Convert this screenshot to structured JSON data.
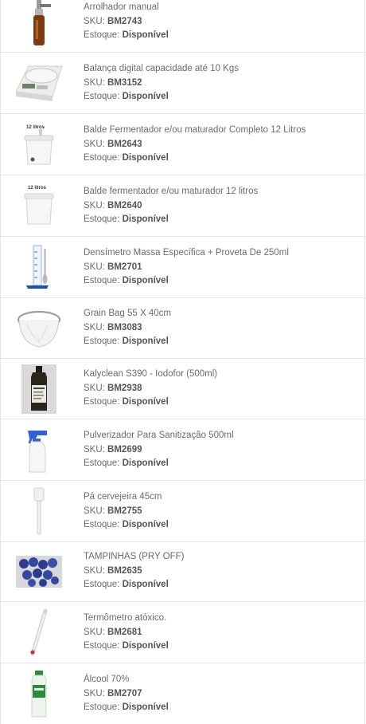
{
  "labels": {
    "sku": "SKU:",
    "stock": "Estoque:"
  },
  "items": [
    {
      "name": "Arrolhador manual",
      "sku": "BM2743",
      "stock": "Disponível",
      "image": "capper-icon"
    },
    {
      "name": "Balança digital capacidade até 10 Kgs",
      "sku": "BM3152",
      "stock": "Disponível",
      "image": "scale-icon"
    },
    {
      "name": "Balde Fermentador e/ou maturador Completo 12 Litros",
      "sku": "BM2643",
      "stock": "Disponível",
      "image": "fermenter-bucket-complete-icon",
      "image_text": "12 litros"
    },
    {
      "name": "Balde fermentador e/ou maturador 12 litros",
      "sku": "BM2640",
      "stock": "Disponível",
      "image": "fermenter-bucket-icon",
      "image_text": "12 litros"
    },
    {
      "name": "Densímetro Massa Específica + Proveta De 250ml",
      "sku": "BM2701",
      "stock": "Disponível",
      "image": "hydrometer-icon"
    },
    {
      "name": "Grain Bag 55 X 40cm",
      "sku": "BM3083",
      "stock": "Disponível",
      "image": "grain-bag-icon"
    },
    {
      "name": "Kalyclean S390 - Iodofor (500ml)",
      "sku": "BM2938",
      "stock": "Disponível",
      "image": "iodofor-bottle-icon"
    },
    {
      "name": "Pulverizador Para Sanitização 500ml",
      "sku": "BM2699",
      "stock": "Disponível",
      "image": "spray-bottle-icon"
    },
    {
      "name": "Pá cervejeira 45cm",
      "sku": "BM2755",
      "stock": "Disponível",
      "image": "brewing-paddle-icon"
    },
    {
      "name": "TAMPINHAS (PRY OFF)",
      "sku": "BM2635",
      "stock": "Disponível",
      "image": "bottle-caps-icon"
    },
    {
      "name": "Termômetro atóxico.",
      "sku": "BM2681",
      "stock": "Disponível",
      "image": "thermometer-icon"
    },
    {
      "name": "Álcool 70%",
      "sku": "BM2707",
      "stock": "Disponível",
      "image": "alcohol-bottle-icon"
    }
  ]
}
